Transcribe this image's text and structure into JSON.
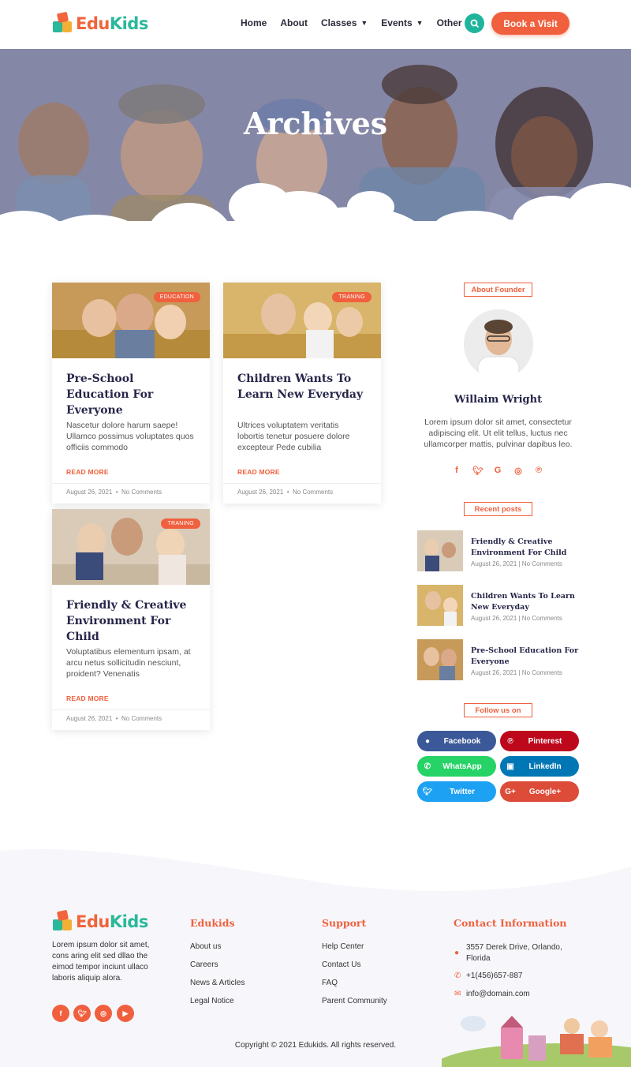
{
  "header": {
    "logo": {
      "part1": "Edu",
      "part2": "Kids"
    },
    "nav": [
      {
        "label": "Home",
        "dropdown": false
      },
      {
        "label": "About",
        "dropdown": false
      },
      {
        "label": "Classes",
        "dropdown": true
      },
      {
        "label": "Events",
        "dropdown": true
      },
      {
        "label": "Other",
        "dropdown": true
      }
    ],
    "search_icon": "search-icon",
    "cta": "Book a Visit"
  },
  "hero": {
    "title": "Archives"
  },
  "posts": [
    {
      "tag": "EDUCATION",
      "title": "Pre-School Education For Everyone",
      "excerpt": "Nascetur dolore harum saepe! Ullamco possimus voluptates quos officiis commodo",
      "more": "READ MORE",
      "date": "August 26, 2021",
      "sep": "•",
      "comments": "No Comments"
    },
    {
      "tag": "TRANING",
      "title": "Children Wants To Learn New Everyday",
      "excerpt": "Ultrices voluptatem veritatis lobortis tenetur posuere dolore excepteur Pede cubilia",
      "more": "READ MORE",
      "date": "August 26, 2021",
      "sep": "•",
      "comments": "No Comments"
    },
    {
      "tag": "TRANING",
      "title": "Friendly & Creative Environment For Child",
      "excerpt": "Voluptatibus elementum ipsam, at arcu netus sollicitudin nesciunt, proident? Venenatis",
      "more": "READ MORE",
      "date": "August 26, 2021",
      "sep": "•",
      "comments": "No Comments"
    }
  ],
  "sidebar": {
    "about_label": "About Founder",
    "founder_name": "Willaim Wright",
    "founder_bio": "Lorem ipsum dolor sit amet, consectetur adipiscing elit. Ut elit tellus, luctus nec ullamcorper mattis, pulvinar dapibus leo.",
    "founder_socials": [
      "facebook-icon",
      "twitter-icon",
      "google-icon",
      "instagram-icon",
      "pinterest-icon"
    ],
    "recent_label": "Recent posts",
    "recent": [
      {
        "title": "Friendly & Creative Environment For Child",
        "meta": "August 26, 2021 | No Comments"
      },
      {
        "title": "Children Wants To Learn New Everyday",
        "meta": "August 26, 2021 | No Comments"
      },
      {
        "title": "Pre-School Education For Everyone",
        "meta": "August 26, 2021 | No Comments"
      }
    ],
    "follow_label": "Follow us on",
    "share": [
      {
        "label": "Facebook",
        "color": "#3b5998",
        "icon": "facebook-icon"
      },
      {
        "label": "Pinterest",
        "color": "#bd081c",
        "icon": "pinterest-icon"
      },
      {
        "label": "WhatsApp",
        "color": "#25d366",
        "icon": "whatsapp-icon"
      },
      {
        "label": "LinkedIn",
        "color": "#0077b5",
        "icon": "linkedin-icon"
      },
      {
        "label": "Twitter",
        "color": "#1da1f2",
        "icon": "twitter-icon"
      },
      {
        "label": "Google+",
        "color": "#dd4b39",
        "icon": "google-plus-icon"
      }
    ]
  },
  "footer": {
    "about": "Lorem ipsum dolor sit amet, cons aring elit sed dllao the eimod tempor inciunt ullaco laboris aliquip alora.",
    "socials": [
      "facebook-icon",
      "twitter-icon",
      "instagram-icon",
      "youtube-icon"
    ],
    "col1": {
      "title": "Edukids",
      "links": [
        "About us",
        "Careers",
        "News & Articles",
        "Legal Notice"
      ]
    },
    "col2": {
      "title": "Support",
      "links": [
        "Help Center",
        "Contact Us",
        "FAQ",
        "Parent Community"
      ]
    },
    "contact": {
      "title": "Contact Information",
      "address": "3557 Derek Drive, Orlando, Florida",
      "phone": "+1(456)657-887",
      "email": "info@domain.com"
    },
    "copyright": "Copyright © 2021 Edukids. All rights reserved."
  },
  "colors": {
    "accent": "#f0603e",
    "teal": "#1fb59d",
    "heading": "#26264a"
  }
}
